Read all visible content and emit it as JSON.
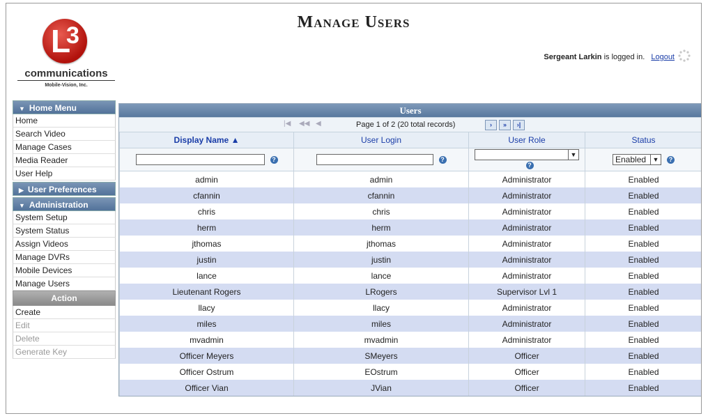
{
  "header": {
    "page_title": "Manage Users",
    "logo_company": "communications",
    "logo_sub": "Mobile-Vision, Inc.",
    "user_name": "Sergeant Larkin",
    "logged_in_text": " is logged in.",
    "logout_label": "Logout"
  },
  "sidebar": {
    "home_menu": {
      "title": "Home Menu",
      "items": [
        "Home",
        "Search Video",
        "Manage Cases",
        "Media Reader",
        "User Help"
      ]
    },
    "user_preferences": {
      "title": "User Preferences"
    },
    "administration": {
      "title": "Administration",
      "items": [
        "System Setup",
        "System Status",
        "Assign Videos",
        "Manage DVRs",
        "Mobile Devices",
        "Manage Users"
      ]
    },
    "action": {
      "title": "Action",
      "items": [
        {
          "label": "Create",
          "enabled": true
        },
        {
          "label": "Edit",
          "enabled": false
        },
        {
          "label": "Delete",
          "enabled": false
        },
        {
          "label": "Generate Key",
          "enabled": false
        }
      ]
    }
  },
  "grid": {
    "title": "Users",
    "pager_text": "Page 1 of 2 (20 total records)",
    "columns": [
      "Display Name ▲",
      "User Login",
      "User Role",
      "Status"
    ],
    "status_filter_value": "Enabled",
    "rows": [
      [
        "admin",
        "admin",
        "Administrator",
        "Enabled"
      ],
      [
        "cfannin",
        "cfannin",
        "Administrator",
        "Enabled"
      ],
      [
        "chris",
        "chris",
        "Administrator",
        "Enabled"
      ],
      [
        "herm",
        "herm",
        "Administrator",
        "Enabled"
      ],
      [
        "jthomas",
        "jthomas",
        "Administrator",
        "Enabled"
      ],
      [
        "justin",
        "justin",
        "Administrator",
        "Enabled"
      ],
      [
        "lance",
        "lance",
        "Administrator",
        "Enabled"
      ],
      [
        "Lieutenant Rogers",
        "LRogers",
        "Supervisor Lvl 1",
        "Enabled"
      ],
      [
        "llacy",
        "llacy",
        "Administrator",
        "Enabled"
      ],
      [
        "miles",
        "miles",
        "Administrator",
        "Enabled"
      ],
      [
        "mvadmin",
        "mvadmin",
        "Administrator",
        "Enabled"
      ],
      [
        "Officer Meyers",
        "SMeyers",
        "Officer",
        "Enabled"
      ],
      [
        "Officer Ostrum",
        "EOstrum",
        "Officer",
        "Enabled"
      ],
      [
        "Officer Vian",
        "JVian",
        "Officer",
        "Enabled"
      ]
    ]
  },
  "colors": {
    "menu_header": "#52729a",
    "link": "#1a3da8",
    "row_alt": "#d4dcf2",
    "logo_red": "#b1120c"
  }
}
